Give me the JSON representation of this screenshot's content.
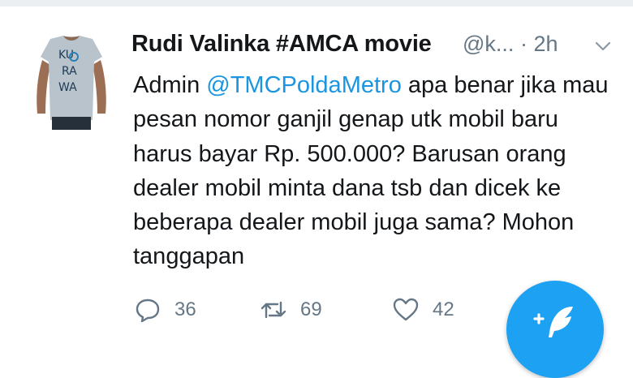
{
  "tweet": {
    "author_name": "Rudi Valinka #AMCA movie",
    "author_handle": "@k...",
    "separator": "·",
    "time": "2h",
    "text_before": "Admin ",
    "mention": "@TMCPoldaMetro",
    "text_after": " apa benar jika mau pesan nomor ganjil genap utk mobil baru harus bayar Rp. 500.000? Barusan orang dealer mobil minta dana tsb dan dicek ke beberapa dealer mobil juga sama? Mohon tanggapan",
    "avatar_shirt_text": [
      "KU",
      "RA",
      "WA"
    ]
  },
  "actions": {
    "reply_count": "36",
    "retweet_count": "69",
    "like_count": "42"
  },
  "icons": {
    "reply": "reply-icon",
    "retweet": "retweet-icon",
    "like": "heart-icon",
    "menu": "chevron-down-icon",
    "compose": "compose-tweet-icon"
  },
  "colors": {
    "link": "#1b95e0",
    "secondary_text": "#657786",
    "fab": "#1da1f2"
  }
}
